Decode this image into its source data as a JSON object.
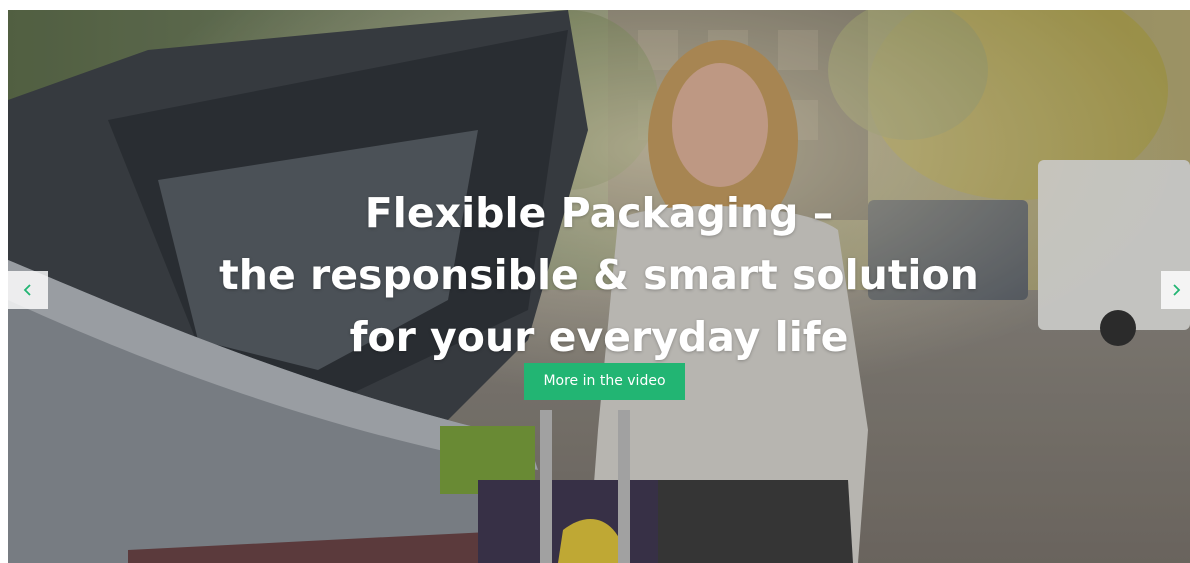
{
  "hero": {
    "headline_line1": "Flexible Packaging –",
    "headline_line2": "the responsible & smart solution",
    "headline_line3": "for your everyday life",
    "cta_label": "More in the video",
    "accent_color": "#22b573",
    "prev_icon": "chevron-left-icon",
    "next_icon": "chevron-right-icon"
  }
}
